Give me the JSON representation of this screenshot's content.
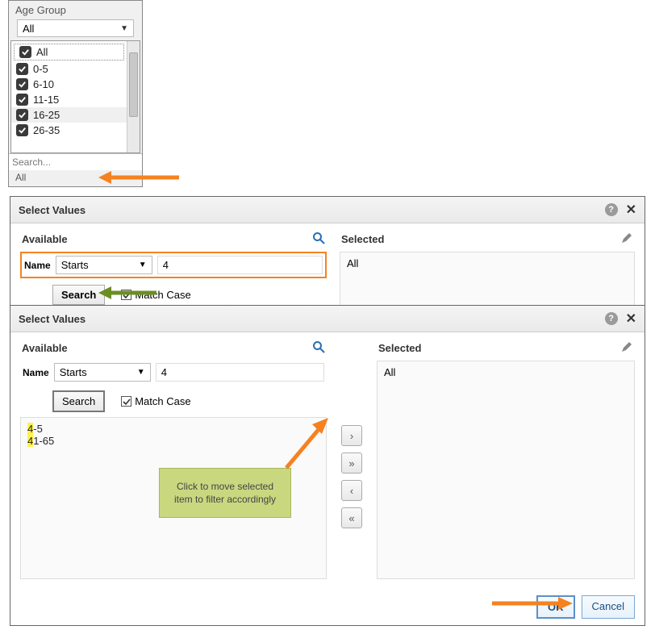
{
  "age_group": {
    "title": "Age Group",
    "combo_value": "All",
    "items": [
      "All",
      "0-5",
      "6-10",
      "11-15",
      "16-25",
      "26-35"
    ],
    "highlighted_index": 4,
    "search_placeholder": "Search...",
    "footer_text": "All"
  },
  "dialog1": {
    "title": "Select Values",
    "available_label": "Available",
    "selected_label": "Selected",
    "name_label": "Name",
    "starts_label": "Starts",
    "name_value": "4",
    "search_btn": "Search",
    "match_case": "Match Case",
    "selected_value": "All"
  },
  "dialog2": {
    "title": "Select Values",
    "available_label": "Available",
    "selected_label": "Selected",
    "name_label": "Name",
    "starts_label": "Starts",
    "name_value": "4",
    "search_btn": "Search",
    "match_case": "Match Case",
    "results": {
      "r0_hl": "4",
      "r0_rest": "-5",
      "r1_hl": "4",
      "r1_rest": "1-65"
    },
    "selected_value": "All",
    "ok_label": "OK",
    "cancel_label": "Cancel"
  },
  "note_text": "Click to move selected item to filter accordingly",
  "colors": {
    "orange": "#f58220",
    "olive": "#6b8e23",
    "blue": "#2a6fb5"
  }
}
